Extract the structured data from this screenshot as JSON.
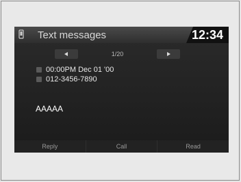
{
  "header": {
    "title": "Text messages",
    "time": "12:34"
  },
  "pager": {
    "page": "1/20",
    "prev_icon": "left-arrow-icon",
    "next_icon": "right-arrow-icon"
  },
  "message": {
    "datetime": "00:00PM Dec 01 '00",
    "sender": "012-3456-7890",
    "body": "AAAAA"
  },
  "softkeys": {
    "reply": "Reply",
    "call": "Call",
    "read": "Read"
  },
  "colors": {
    "screen_bg": "#1b1b1b",
    "header_bg": "#3a3a3a",
    "clock_bg": "#111111",
    "text": "#ffffff"
  }
}
